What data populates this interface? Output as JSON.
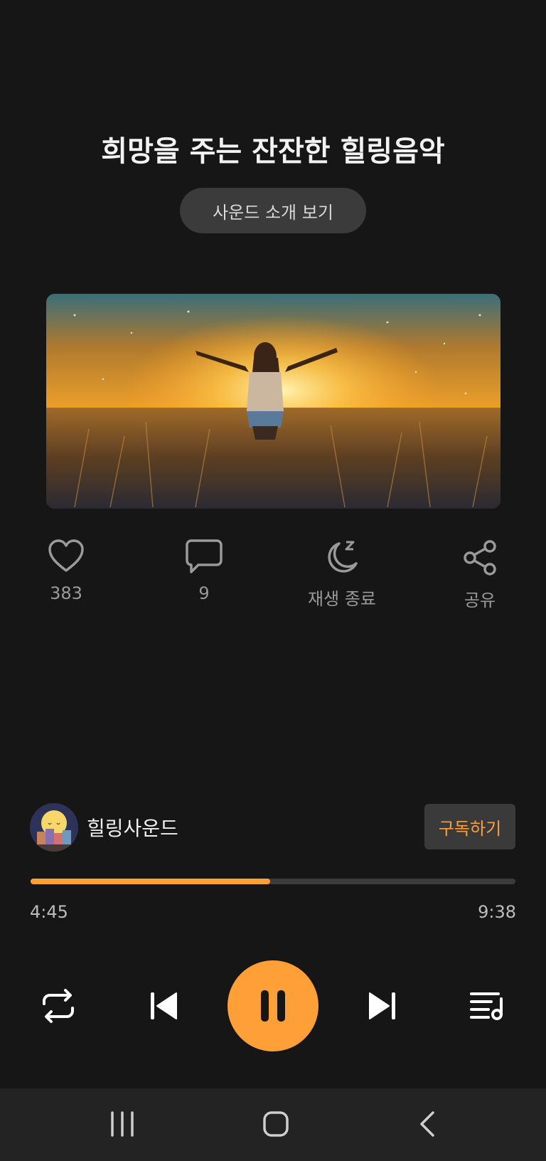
{
  "title": "희망을 주는 잔잔한 힐링음악",
  "intro_button": "사운드 소개 보기",
  "cover": {
    "alt": "cover-image"
  },
  "actions": {
    "like": {
      "icon": "heart-icon",
      "label": "383"
    },
    "comment": {
      "icon": "comment-icon",
      "label": "9"
    },
    "sleep": {
      "icon": "moon-sleep-icon",
      "label": "재생 종료"
    },
    "share": {
      "icon": "share-icon",
      "label": "공유"
    }
  },
  "channel": {
    "name": "힐링사운드",
    "subscribe_label": "구독하기"
  },
  "player": {
    "elapsed": "4:45",
    "duration": "9:38",
    "progress_fraction": 0.494,
    "accent_color": "#ff9f38",
    "controls": [
      "repeat-icon",
      "previous-icon",
      "pause-icon",
      "next-icon",
      "playlist-icon"
    ]
  },
  "system_nav": [
    "recent-apps-icon",
    "home-icon",
    "back-icon"
  ]
}
